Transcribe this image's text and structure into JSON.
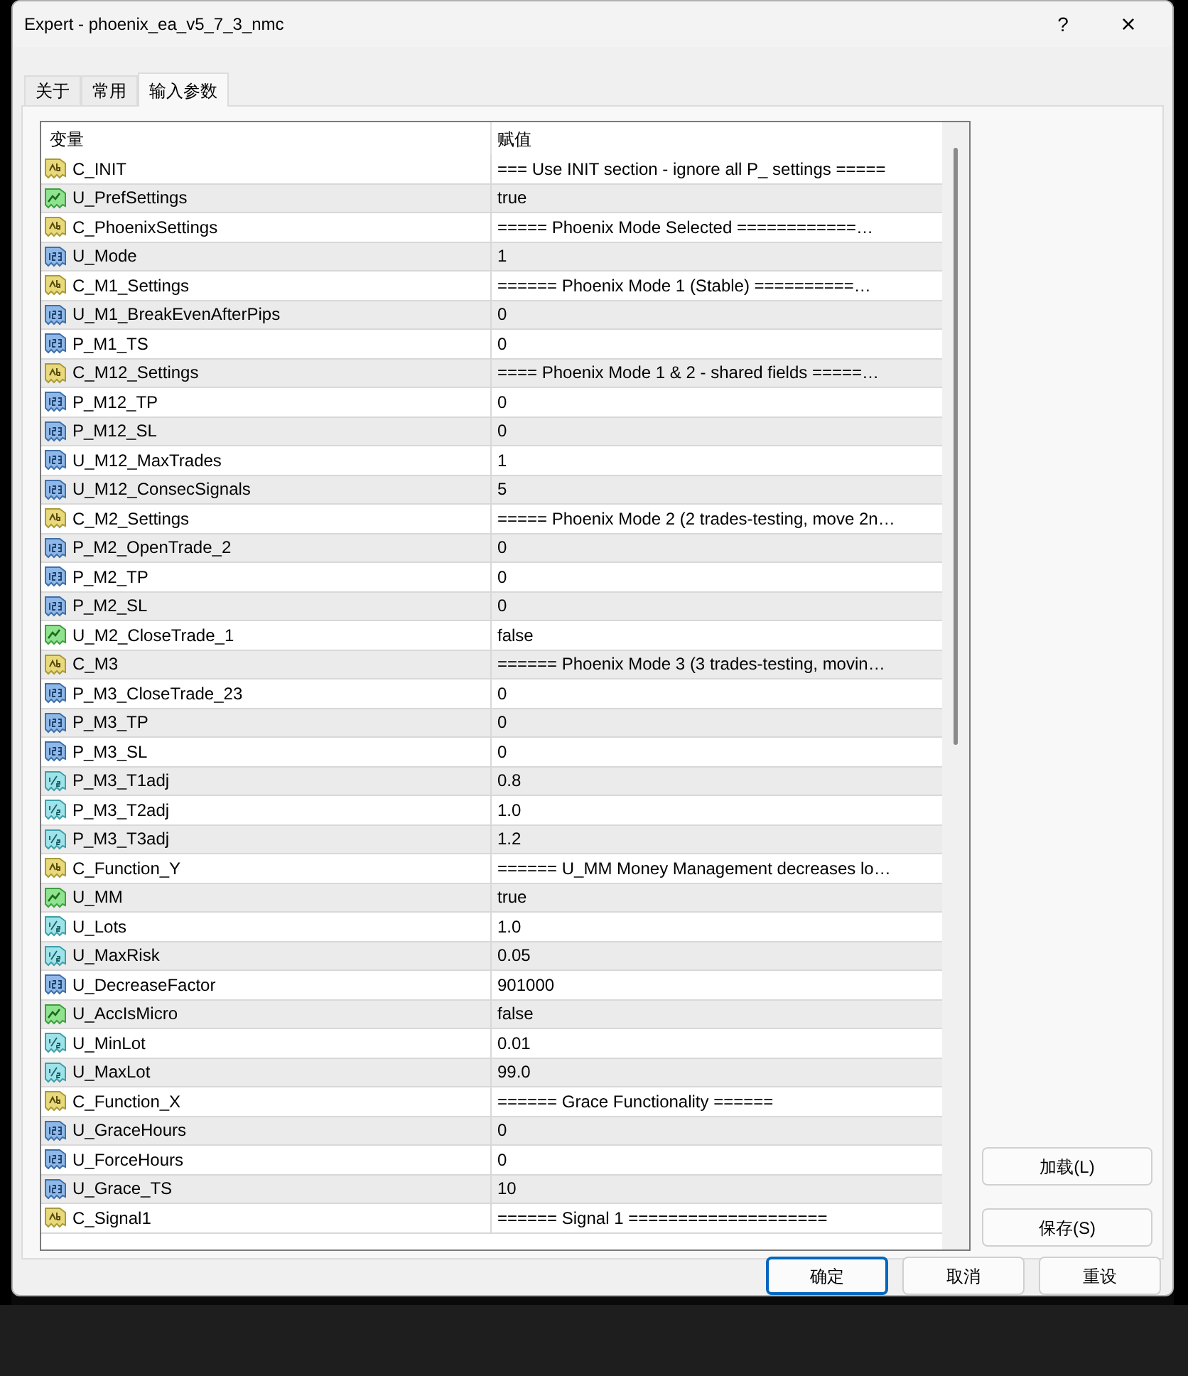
{
  "window": {
    "title": "Expert - phoenix_ea_v5_7_3_nmc",
    "help": "?",
    "close": "×"
  },
  "tabs": [
    {
      "label": "关于",
      "selected": false
    },
    {
      "label": "常用",
      "selected": false
    },
    {
      "label": "输入参数",
      "selected": true
    }
  ],
  "table": {
    "columns": [
      "变量",
      "赋值"
    ],
    "rows": [
      {
        "kind": "string",
        "name": "C_INIT",
        "value": "=== Use INIT section - ignore all P_ settings ====="
      },
      {
        "kind": "bool",
        "name": "U_PrefSettings",
        "value": "true"
      },
      {
        "kind": "string",
        "name": "C_PhoenixSettings",
        "value": "===== Phoenix Mode Selected ============…"
      },
      {
        "kind": "int",
        "name": "U_Mode",
        "value": "1"
      },
      {
        "kind": "string",
        "name": "C_M1_Settings",
        "value": "====== Phoenix Mode 1 (Stable) ==========…"
      },
      {
        "kind": "int",
        "name": "U_M1_BreakEvenAfterPips",
        "value": "0"
      },
      {
        "kind": "int",
        "name": "P_M1_TS",
        "value": "0"
      },
      {
        "kind": "string",
        "name": "C_M12_Settings",
        "value": "==== Phoenix Mode 1 & 2 - shared fields =====…"
      },
      {
        "kind": "int",
        "name": "P_M12_TP",
        "value": "0"
      },
      {
        "kind": "int",
        "name": "P_M12_SL",
        "value": "0"
      },
      {
        "kind": "int",
        "name": "U_M12_MaxTrades",
        "value": "1"
      },
      {
        "kind": "int",
        "name": "U_M12_ConsecSignals",
        "value": "5"
      },
      {
        "kind": "string",
        "name": "C_M2_Settings",
        "value": "===== Phoenix Mode 2 (2 trades-testing, move 2n…"
      },
      {
        "kind": "int",
        "name": "P_M2_OpenTrade_2",
        "value": "0"
      },
      {
        "kind": "int",
        "name": "P_M2_TP",
        "value": "0"
      },
      {
        "kind": "int",
        "name": "P_M2_SL",
        "value": "0"
      },
      {
        "kind": "bool",
        "name": "U_M2_CloseTrade_1",
        "value": "false"
      },
      {
        "kind": "string",
        "name": "C_M3",
        "value": "====== Phoenix Mode 3 (3 trades-testing, movin…"
      },
      {
        "kind": "int",
        "name": "P_M3_CloseTrade_23",
        "value": "0"
      },
      {
        "kind": "int",
        "name": "P_M3_TP",
        "value": "0"
      },
      {
        "kind": "int",
        "name": "P_M3_SL",
        "value": "0"
      },
      {
        "kind": "double",
        "name": "P_M3_T1adj",
        "value": "0.8"
      },
      {
        "kind": "double",
        "name": "P_M3_T2adj",
        "value": "1.0"
      },
      {
        "kind": "double",
        "name": "P_M3_T3adj",
        "value": "1.2"
      },
      {
        "kind": "string",
        "name": "C_Function_Y",
        "value": "====== U_MM Money Management decreases lo…"
      },
      {
        "kind": "bool",
        "name": "U_MM",
        "value": "true"
      },
      {
        "kind": "double",
        "name": "U_Lots",
        "value": "1.0"
      },
      {
        "kind": "double",
        "name": "U_MaxRisk",
        "value": "0.05"
      },
      {
        "kind": "int",
        "name": "U_DecreaseFactor",
        "value": "901000"
      },
      {
        "kind": "bool",
        "name": "U_AccIsMicro",
        "value": "false"
      },
      {
        "kind": "double",
        "name": "U_MinLot",
        "value": "0.01"
      },
      {
        "kind": "double",
        "name": "U_MaxLot",
        "value": "99.0"
      },
      {
        "kind": "string",
        "name": "C_Function_X",
        "value": "====== Grace Functionality ======"
      },
      {
        "kind": "int",
        "name": "U_GraceHours",
        "value": "0"
      },
      {
        "kind": "int",
        "name": "U_ForceHours",
        "value": "0"
      },
      {
        "kind": "int",
        "name": "U_Grace_TS",
        "value": "10"
      },
      {
        "kind": "string",
        "name": "C_Signal1",
        "value": "====== Signal 1 ===================="
      }
    ]
  },
  "side_buttons": [
    "加载(L)",
    "保存(S)"
  ],
  "buttons": [
    {
      "label": "确定",
      "default": true
    },
    {
      "label": "取消",
      "default": false
    },
    {
      "label": "重设",
      "default": false
    }
  ]
}
